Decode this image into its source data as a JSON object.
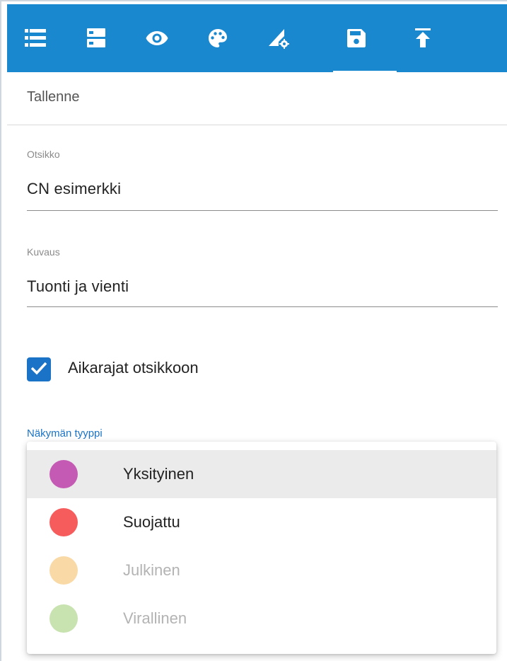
{
  "toolbar": {
    "color": "#1a88cf",
    "tabs": [
      {
        "icon": "list-icon"
      },
      {
        "icon": "server-icon"
      },
      {
        "icon": "eye-icon"
      },
      {
        "icon": "palette-icon"
      },
      {
        "icon": "signal-settings-icon"
      },
      {
        "icon": "save-icon",
        "active": true
      },
      {
        "icon": "upload-icon"
      }
    ]
  },
  "section": {
    "title": "Tallenne"
  },
  "form": {
    "title_label": "Otsikko",
    "title_value": "CN esimerkki",
    "description_label": "Kuvaus",
    "description_value": "Tuonti ja vienti",
    "checkbox_label": "Aikarajat otsikkoon",
    "checkbox_checked": true,
    "view_type_label": "Näkymän tyyppi"
  },
  "dropdown": {
    "options": [
      {
        "label": "Yksityinen",
        "color": "#c45ab3",
        "selected": true,
        "enabled": true
      },
      {
        "label": "Suojattu",
        "color": "#f65c5c",
        "selected": false,
        "enabled": true
      },
      {
        "label": "Julkinen",
        "color": "#f9d9a6",
        "selected": false,
        "enabled": false
      },
      {
        "label": "Virallinen",
        "color": "#c8e2b0",
        "selected": false,
        "enabled": false
      }
    ]
  }
}
